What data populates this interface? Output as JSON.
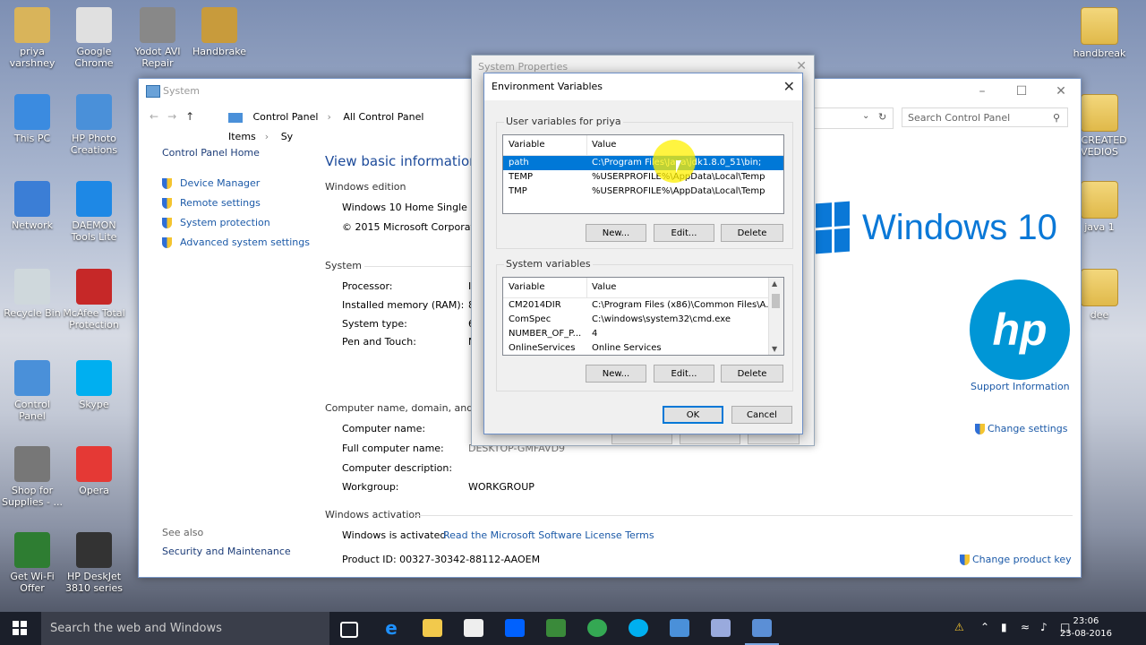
{
  "desktop": {
    "left_icons": [
      {
        "label": "priya\nvarshney",
        "icon": "user-folder-icon"
      },
      {
        "label": "Google\nChrome",
        "icon": "chrome-icon"
      },
      {
        "label": "Yodot AVI\nRepair",
        "icon": "yodot-icon"
      },
      {
        "label": "Handbrake",
        "icon": "handbrake-icon"
      },
      {
        "label": "This PC",
        "icon": "computer-icon"
      },
      {
        "label": "HP Photo\nCreations",
        "icon": "hp-photo-icon"
      },
      {
        "label": "Network",
        "icon": "network-icon"
      },
      {
        "label": "DAEMON\nTools Lite",
        "icon": "daemon-icon"
      },
      {
        "label": "Recycle Bin",
        "icon": "recycle-bin-icon"
      },
      {
        "label": "McAfee Total\nProtection",
        "icon": "mcafee-icon"
      },
      {
        "label": "Control\nPanel",
        "icon": "control-panel-icon"
      },
      {
        "label": "Skype",
        "icon": "skype-icon"
      },
      {
        "label": "Shop for\nSupplies - ...",
        "icon": "printer-icon"
      },
      {
        "label": "Opera",
        "icon": "opera-icon"
      },
      {
        "label": "Get Wi-Fi\nOffer",
        "icon": "wifi-offer-icon"
      },
      {
        "label": "HP DeskJet\n3810 series",
        "icon": "hp-printer-icon"
      }
    ],
    "right_icons": [
      {
        "label": "handbreak",
        "icon": "folder-icon"
      },
      {
        "label": "Y CREATED\nVEDIOS",
        "icon": "folder-icon"
      },
      {
        "label": "java 1",
        "icon": "folder-icon"
      },
      {
        "label": "dee",
        "icon": "folder-icon"
      }
    ]
  },
  "system_window": {
    "title": "System",
    "breadcrumb": [
      "Control Panel",
      "All Control Panel Items",
      "Sy"
    ],
    "search_placeholder": "Search Control Panel",
    "left_panel": {
      "home": "Control Panel Home",
      "links": [
        "Device Manager",
        "Remote settings",
        "System protection",
        "Advanced system settings"
      ],
      "see_also": "See also",
      "security": "Security and Maintenance"
    },
    "heading": "View basic information al",
    "windows_edition": {
      "label": "Windows edition",
      "edition": "Windows 10 Home Single Lan",
      "copyright": "© 2015 Microsoft Corporatio"
    },
    "system": {
      "label": "System",
      "rows": [
        "Processor:",
        "Installed memory (RAM):",
        "System type:",
        "Pen and Touch:"
      ],
      "values": [
        "I",
        "8",
        "6",
        "N"
      ]
    },
    "computer": {
      "label": "Computer name, domain, and w",
      "rows": [
        "Computer name:",
        "Full computer name:",
        "Computer description:",
        "Workgroup:"
      ],
      "values": [
        "",
        "DESKTOP-GMFAVD9",
        "",
        "WORKGROUP"
      ],
      "change_settings": "Change settings"
    },
    "activation": {
      "label": "Windows activation",
      "status": "Windows is activated",
      "license_link": "Read the Microsoft Software License Terms",
      "product_id": "Product ID: 00327-30342-88112-AAOEM",
      "change_key": "Change product key"
    },
    "windows10_logo_text": "Windows 10",
    "hp_logo_text": "hp",
    "support_info": "Support Information"
  },
  "props_dialog": {
    "title": "System Properties",
    "close": "✕"
  },
  "env_dialog": {
    "title": "Environment Variables",
    "close": "✕",
    "user_group": "User variables for priya",
    "system_group": "System variables",
    "col_variable": "Variable",
    "col_value": "Value",
    "user_vars": [
      {
        "name": "path",
        "value": "C:\\Program Files\\Java\\jdk1.8.0_51\\bin;",
        "selected": true
      },
      {
        "name": "TEMP",
        "value": "%USERPROFILE%\\AppData\\Local\\Temp",
        "selected": false
      },
      {
        "name": "TMP",
        "value": "%USERPROFILE%\\AppData\\Local\\Temp",
        "selected": false
      }
    ],
    "system_vars": [
      {
        "name": "CM2014DIR",
        "value": "C:\\Program Files (x86)\\Common Files\\A..."
      },
      {
        "name": "ComSpec",
        "value": "C:\\windows\\system32\\cmd.exe"
      },
      {
        "name": "NUMBER_OF_P...",
        "value": "4"
      },
      {
        "name": "OnlineServices",
        "value": "Online Services"
      }
    ],
    "btn_new": "New...",
    "btn_edit": "Edit...",
    "btn_delete": "Delete",
    "btn_ok": "OK",
    "btn_cancel": "Cancel"
  },
  "taskbar": {
    "search_placeholder": "Search the web and Windows",
    "time": "23:06",
    "date": "23-08-2016"
  }
}
